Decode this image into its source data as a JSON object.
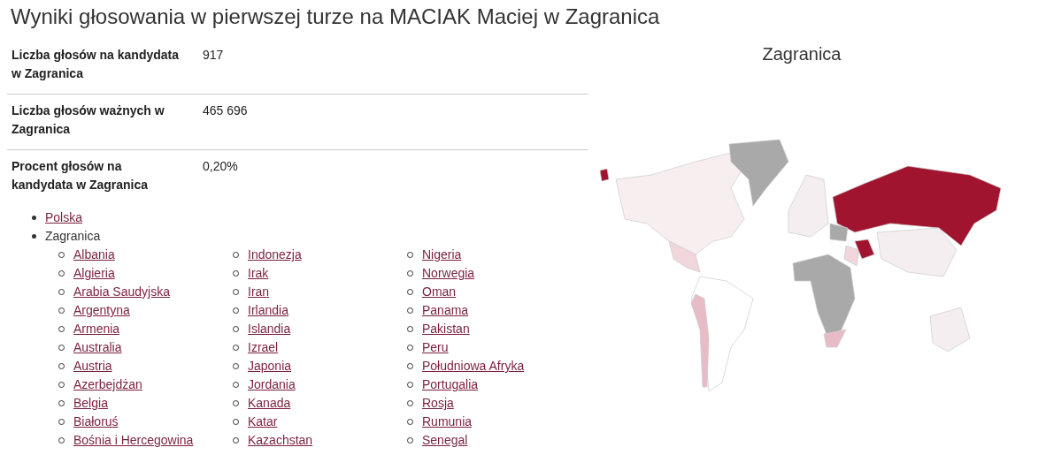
{
  "title": "Wyniki głosowania w pierwszej turze na MACIAK Maciej w Zagranica",
  "stats": [
    {
      "label": "Liczba głosów na kandydata w Zagranica",
      "value": "917"
    },
    {
      "label": "Liczba głosów ważnych w Zagranica",
      "value": "465 696"
    },
    {
      "label": "Procent głosów na kandydata w Zagranica",
      "value": "0,20%"
    }
  ],
  "regions": [
    {
      "name": "Polska",
      "link": true
    },
    {
      "name": "Zagranica",
      "link": false,
      "children": [
        "Albania",
        "Algieria",
        "Arabia Saudyjska",
        "Argentyna",
        "Armenia",
        "Australia",
        "Austria",
        "Azerbejdżan",
        "Belgia",
        "Białoruś",
        "Bośnia i Hercegowina",
        "Indonezja",
        "Irak",
        "Iran",
        "Irlandia",
        "Islandia",
        "Izrael",
        "Japonia",
        "Jordania",
        "Kanada",
        "Katar",
        "Kazachstan",
        "Nigeria",
        "Norwegia",
        "Oman",
        "Panama",
        "Pakistan",
        "Peru",
        "Południowa Afryka",
        "Portugalia",
        "Rosja",
        "Rumunia",
        "Senegal"
      ]
    }
  ],
  "map": {
    "title": "Zagranica"
  }
}
